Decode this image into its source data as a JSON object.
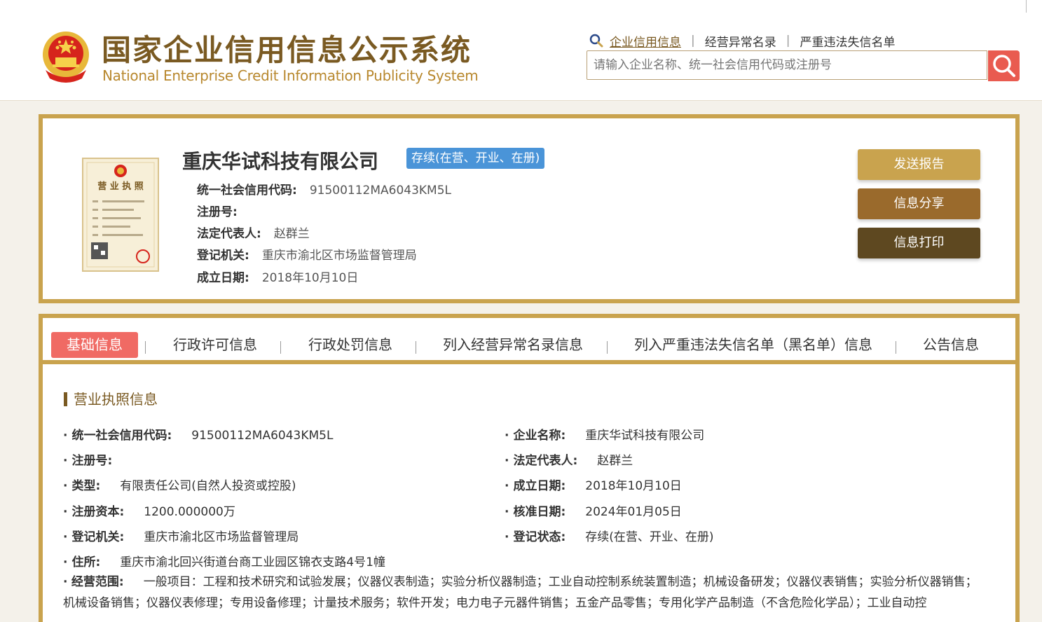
{
  "header": {
    "title_cn": "国家企业信用信息公示系统",
    "title_en": "National Enterprise Credit Information Publicity System",
    "links": [
      "企业信用信息",
      "经营异常名录",
      "严重违法失信名单"
    ],
    "search_placeholder": "请输入企业名称、统一社会信用代码或注册号"
  },
  "company": {
    "name": "重庆华试科技有限公司",
    "status": "存续(在营、开业、在册)",
    "fields": [
      {
        "label": "统一社会信用代码:",
        "value": "91500112MA6043KM5L"
      },
      {
        "label": "注册号:",
        "value": ""
      },
      {
        "label": "法定代表人:",
        "value": "赵群兰"
      },
      {
        "label": "登记机关:",
        "value": "重庆市渝北区市场监督管理局"
      },
      {
        "label": "成立日期:",
        "value": "2018年10月10日"
      }
    ],
    "license_title": "营 业 执 照",
    "buttons": [
      "发送报告",
      "信息分享",
      "信息打印"
    ]
  },
  "tabs": [
    "基础信息",
    "行政许可信息",
    "行政处罚信息",
    "列入经营异常名录信息",
    "列入严重违法失信名单（黑名单）信息",
    "公告信息"
  ],
  "section": {
    "title": "营业执照信息",
    "left": [
      {
        "label": "统一社会信用代码:",
        "value": "91500112MA6043KM5L"
      },
      {
        "label": "注册号:",
        "value": ""
      },
      {
        "label": "类型:",
        "value": "有限责任公司(自然人投资或控股)"
      },
      {
        "label": "注册资本:",
        "value": "1200.000000万"
      },
      {
        "label": "登记机关:",
        "value": "重庆市渝北区市场监督管理局"
      },
      {
        "label": "住所:",
        "value": "重庆市渝北回兴街道台商工业园区锦衣支路4号1幢"
      }
    ],
    "right": [
      {
        "label": "企业名称:",
        "value": "重庆华试科技有限公司"
      },
      {
        "label": "法定代表人:",
        "value": "赵群兰"
      },
      {
        "label": "成立日期:",
        "value": "2018年10月10日"
      },
      {
        "label": "核准日期:",
        "value": "2024年01月05日"
      },
      {
        "label": "登记状态:",
        "value": "存续(在营、开业、在册)"
      }
    ],
    "scope_label": "经营范围:",
    "scope_value": "一般项目：工程和技术研究和试验发展；仪器仪表制造；实验分析仪器制造；工业自动控制系统装置制造；机械设备研发；仪器仪表销售；实验分析仪器销售；机械设备销售；仪器仪表修理；专用设备修理；计量技术服务；软件开发；电力电子元器件销售；五金产品零售；专用化学产品制造（不含危险化学品）；工业自动控"
  },
  "colors": {
    "gold": "#c9a34e",
    "brown": "#7a5a22",
    "badge": "#4a94d8",
    "tab_active": "#f06a64",
    "search_btn": "#e95b50"
  }
}
